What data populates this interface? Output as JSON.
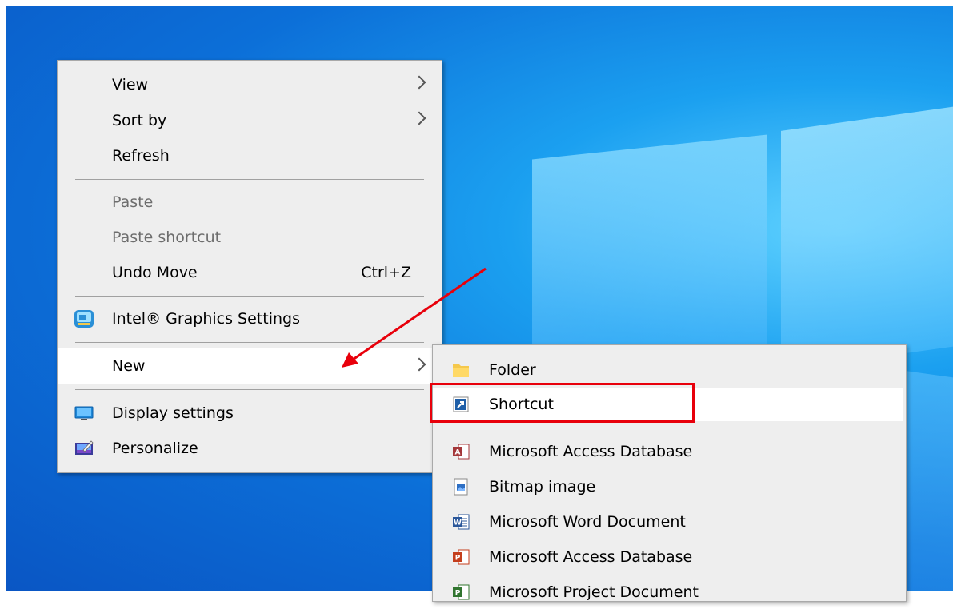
{
  "context_menu": {
    "items": [
      {
        "label": "View",
        "submenu": true
      },
      {
        "label": "Sort by",
        "submenu": true
      },
      {
        "label": "Refresh"
      },
      {
        "label": "Paste",
        "disabled": true
      },
      {
        "label": "Paste shortcut",
        "disabled": true
      },
      {
        "label": "Undo Move",
        "shortcut": "Ctrl+Z"
      },
      {
        "label": "Intel® Graphics Settings",
        "icon": "intel-graphics-icon"
      },
      {
        "label": "New",
        "submenu": true,
        "highlighted": true
      },
      {
        "label": "Display settings",
        "icon": "display-icon"
      },
      {
        "label": "Personalize",
        "icon": "personalize-icon"
      }
    ]
  },
  "new_submenu": {
    "items": [
      {
        "label": "Folder",
        "icon": "folder-icon"
      },
      {
        "label": "Shortcut",
        "icon": "shortcut-icon",
        "highlighted": true
      },
      {
        "label": "Microsoft Access Database",
        "icon": "access-icon"
      },
      {
        "label": "Bitmap image",
        "icon": "bitmap-icon"
      },
      {
        "label": "Microsoft Word Document",
        "icon": "word-icon"
      },
      {
        "label": "Microsoft Access Database",
        "icon": "access-icon"
      },
      {
        "label": "Microsoft Project Document",
        "icon": "project-icon"
      }
    ]
  },
  "annotations": {
    "arrow_color": "#e8000b",
    "highlight_target": "Shortcut"
  },
  "colors": {
    "menu_bg": "#eeeeee",
    "hover_bg": "#ffffff",
    "disabled_text": "#6d6d6d"
  }
}
